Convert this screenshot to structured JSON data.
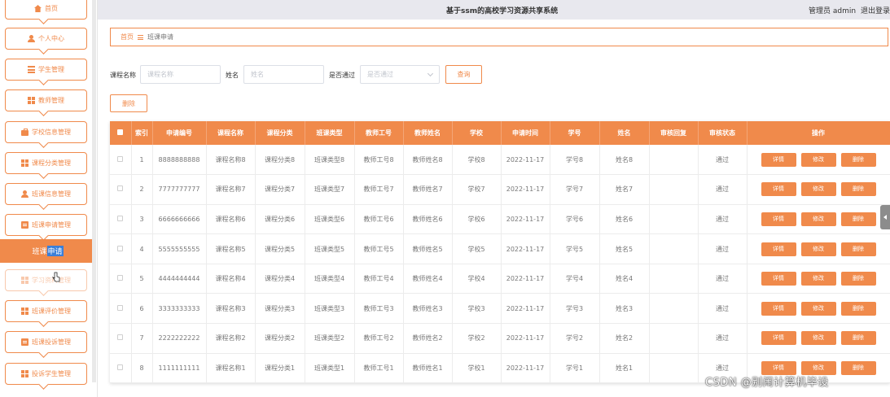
{
  "header": {
    "app_title": "基于ssm的高校学习资源共享系统",
    "role_label": "管理员 admin",
    "logout_label": "退出登录"
  },
  "sidebar": {
    "items": [
      {
        "label": "首页",
        "icon": "home-icon"
      },
      {
        "label": "个人中心",
        "icon": "user-icon"
      },
      {
        "label": "学生管理",
        "icon": "list-icon"
      },
      {
        "label": "教师管理",
        "icon": "grid-icon"
      },
      {
        "label": "学校信息管理",
        "icon": "briefcase-icon"
      },
      {
        "label": "课程分类管理",
        "icon": "grid-icon"
      },
      {
        "label": "班课信息管理",
        "icon": "user-icon"
      },
      {
        "label": "班课申请管理",
        "icon": "card-icon"
      },
      {
        "label": "学习资料管理",
        "icon": "grid-icon"
      },
      {
        "label": "班课评价管理",
        "icon": "grid-icon"
      },
      {
        "label": "班课投诉管理",
        "icon": "card-icon"
      },
      {
        "label": "投诉学生管理",
        "icon": "grid-icon"
      }
    ],
    "active_sub_prefix": "班课",
    "active_sub_highlight": "申请"
  },
  "breadcrumb": {
    "home": "首页",
    "current": "班课申请"
  },
  "search": {
    "course_label": "课程名称",
    "course_placeholder": "课程名称",
    "name_label": "姓名",
    "name_placeholder": "姓名",
    "approved_label": "是否通过",
    "approved_placeholder": "是否通过",
    "query_button": "查询",
    "delete_button": "删除"
  },
  "table": {
    "columns": [
      "索引",
      "申请编号",
      "课程名称",
      "课程分类",
      "班课类型",
      "教师工号",
      "教师姓名",
      "学校",
      "申请时间",
      "学号",
      "姓名",
      "审核回复",
      "审核状态",
      "操作"
    ],
    "rows": [
      {
        "index": "1",
        "app_no": "8888888888",
        "course": "课程名称8",
        "category": "课程分类8",
        "class_type": "班课类型8",
        "teacher_no": "教师工号8",
        "teacher_name": "教师姓名8",
        "school": "学校8",
        "time": "2022-11-17",
        "student_no": "学号8",
        "name": "姓名8",
        "reply": "",
        "status": "通过"
      },
      {
        "index": "2",
        "app_no": "7777777777",
        "course": "课程名称7",
        "category": "课程分类7",
        "class_type": "班课类型7",
        "teacher_no": "教师工号7",
        "teacher_name": "教师姓名7",
        "school": "学校7",
        "time": "2022-11-17",
        "student_no": "学号7",
        "name": "姓名7",
        "reply": "",
        "status": "通过"
      },
      {
        "index": "3",
        "app_no": "6666666666",
        "course": "课程名称6",
        "category": "课程分类6",
        "class_type": "班课类型6",
        "teacher_no": "教师工号6",
        "teacher_name": "教师姓名6",
        "school": "学校6",
        "time": "2022-11-17",
        "student_no": "学号6",
        "name": "姓名6",
        "reply": "",
        "status": "通过"
      },
      {
        "index": "4",
        "app_no": "5555555555",
        "course": "课程名称5",
        "category": "课程分类5",
        "class_type": "班课类型5",
        "teacher_no": "教师工号5",
        "teacher_name": "教师姓名5",
        "school": "学校5",
        "time": "2022-11-17",
        "student_no": "学号5",
        "name": "姓名5",
        "reply": "",
        "status": "通过"
      },
      {
        "index": "5",
        "app_no": "4444444444",
        "course": "课程名称4",
        "category": "课程分类4",
        "class_type": "班课类型4",
        "teacher_no": "教师工号4",
        "teacher_name": "教师姓名4",
        "school": "学校4",
        "time": "2022-11-17",
        "student_no": "学号4",
        "name": "姓名4",
        "reply": "",
        "status": "通过"
      },
      {
        "index": "6",
        "app_no": "3333333333",
        "course": "课程名称3",
        "category": "课程分类3",
        "class_type": "班课类型3",
        "teacher_no": "教师工号3",
        "teacher_name": "教师姓名3",
        "school": "学校3",
        "time": "2022-11-17",
        "student_no": "学号3",
        "name": "姓名3",
        "reply": "",
        "status": "通过"
      },
      {
        "index": "7",
        "app_no": "2222222222",
        "course": "课程名称2",
        "category": "课程分类2",
        "class_type": "班课类型2",
        "teacher_no": "教师工号2",
        "teacher_name": "教师姓名2",
        "school": "学校2",
        "time": "2022-11-17",
        "student_no": "学号2",
        "name": "姓名2",
        "reply": "",
        "status": "通过"
      },
      {
        "index": "8",
        "app_no": "1111111111",
        "course": "课程名称1",
        "category": "课程分类1",
        "class_type": "班课类型1",
        "teacher_no": "教师工号1",
        "teacher_name": "教师姓名1",
        "school": "学校1",
        "time": "2022-11-17",
        "student_no": "学号1",
        "name": "姓名1",
        "reply": "",
        "status": "通过"
      }
    ],
    "actions": {
      "detail": "详情",
      "edit": "修改",
      "delete": "删除"
    }
  },
  "watermark": "CSDN @别闹计算机毕设",
  "colors": {
    "accent": "#f08a4b",
    "topbar": "#e8e8ee",
    "highlight": "#3b7fd9"
  }
}
